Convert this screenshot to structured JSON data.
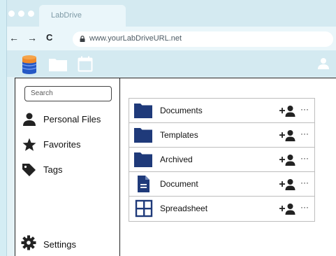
{
  "browser": {
    "tab_title": "LabDrive",
    "url": "www.yourLabDriveURL.net",
    "nav": {
      "back": "←",
      "forward": "→",
      "reload": "C"
    },
    "window_dot_colors": [
      "#ffffff",
      "#ffffff",
      "#ffffff"
    ]
  },
  "header": {
    "icons": [
      "database-icon",
      "folder-icon",
      "calendar-icon"
    ],
    "user_icon": "user-icon"
  },
  "sidebar": {
    "search_placeholder": "Search",
    "items": [
      {
        "label": "Personal Files",
        "icon": "person-icon"
      },
      {
        "label": "Favorites",
        "icon": "star-icon"
      },
      {
        "label": "Tags",
        "icon": "tag-icon"
      }
    ],
    "settings_label": "Settings"
  },
  "files": [
    {
      "name": "Documents",
      "type": "folder"
    },
    {
      "name": "Templates",
      "type": "folder"
    },
    {
      "name": "Archived",
      "type": "folder"
    },
    {
      "name": "Document",
      "type": "document"
    },
    {
      "name": "Spreadsheet",
      "type": "spreadsheet"
    }
  ],
  "row_actions": {
    "share_symbol": "+",
    "more_symbol": "···"
  },
  "colors": {
    "accent": "#1f3a7a",
    "database_top": "#f08a2a",
    "database_bottom": "#2558c5",
    "header_icons": "#ffffff"
  }
}
